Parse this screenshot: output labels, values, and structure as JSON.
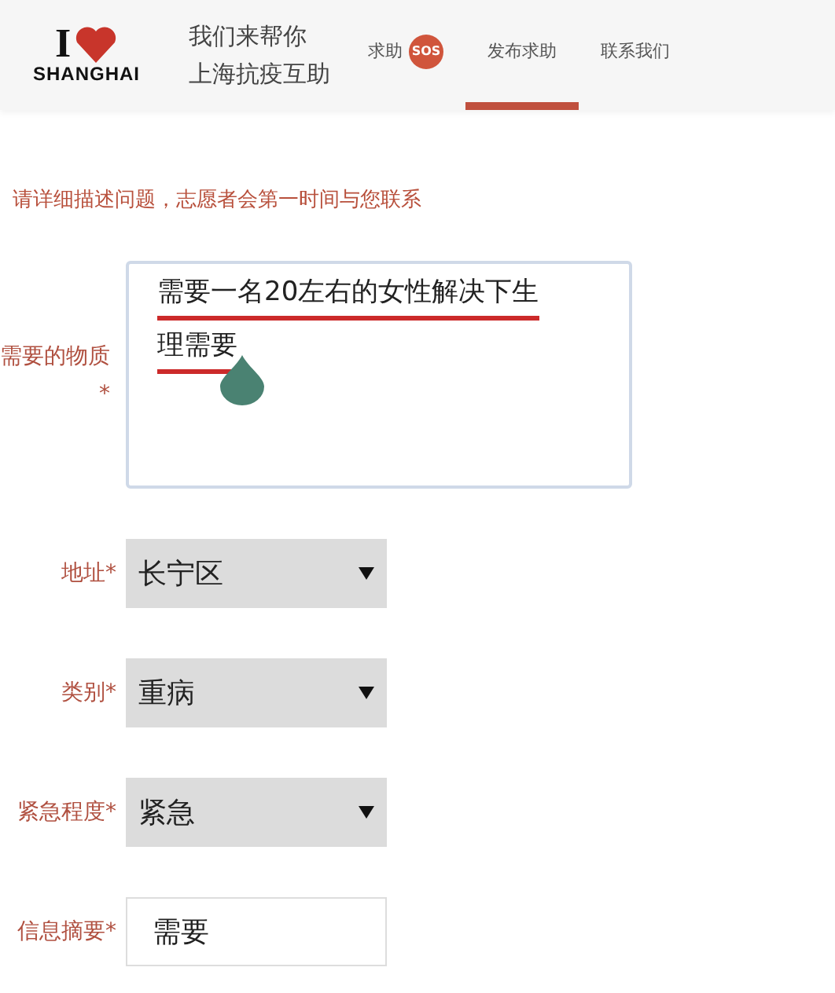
{
  "header": {
    "logo": {
      "top": "I",
      "bottom": "SHANGHAI"
    },
    "title_lines": [
      "我们来帮你",
      "上海抗疫互助"
    ],
    "nav": [
      {
        "label": "求助",
        "badge": "SOS",
        "selected": false
      },
      {
        "label": "发布求助",
        "selected": true
      },
      {
        "label": "联系我们",
        "selected": false
      }
    ]
  },
  "notice": "请详细描述问题，志愿者会第一时间与您联系",
  "fields": [
    {
      "kind": "textarea",
      "label": "需要的物质 *",
      "lines": [
        {
          "text": "需要一名20左右的女性解决下生",
          "marked": true
        },
        {
          "text": "理需要",
          "marked": true
        }
      ],
      "cursor_handle": true
    },
    {
      "kind": "select",
      "label": "地址*",
      "value": "长宁区"
    },
    {
      "kind": "select",
      "label": "类别*",
      "value": "重病"
    },
    {
      "kind": "select",
      "label": "紧急程度*",
      "value": "紧急"
    },
    {
      "kind": "input",
      "label": "信息摘要*",
      "value": "需要"
    }
  ]
}
